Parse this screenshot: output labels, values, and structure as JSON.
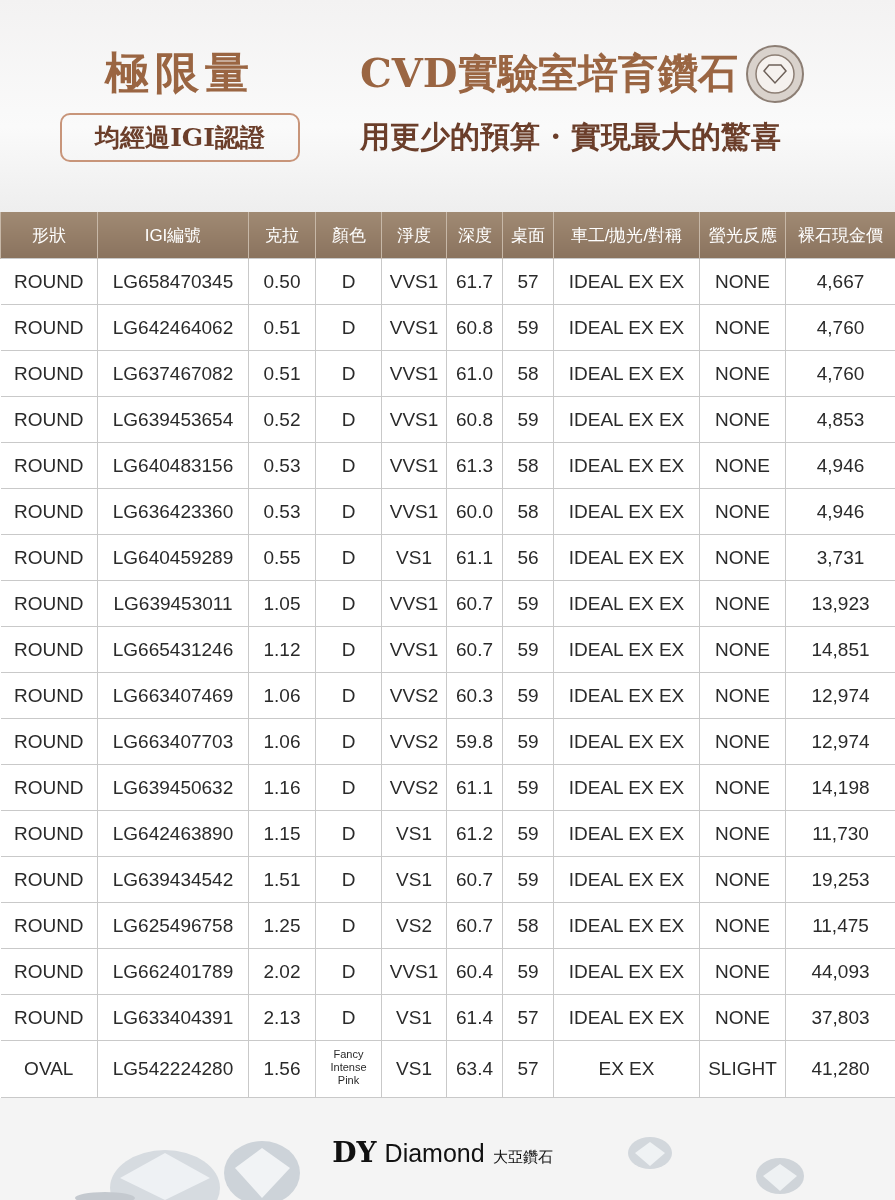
{
  "banner": {
    "headline": "極限量",
    "title": "CVD實驗室培育鑽石",
    "badge": "均經過IGI認證",
    "slogan": "用更少的預算 · 實現最大的驚喜"
  },
  "table": {
    "columns": [
      "形狀",
      "IGI編號",
      "克拉",
      "顏色",
      "淨度",
      "深度",
      "桌面",
      "車工/拋光/對稱",
      "螢光反應",
      "裸石現金價"
    ],
    "rows": [
      [
        "ROUND",
        "LG658470345",
        "0.50",
        "D",
        "VVS1",
        "61.7",
        "57",
        "IDEAL EX EX",
        "NONE",
        "4,667"
      ],
      [
        "ROUND",
        "LG642464062",
        "0.51",
        "D",
        "VVS1",
        "60.8",
        "59",
        "IDEAL EX EX",
        "NONE",
        "4,760"
      ],
      [
        "ROUND",
        "LG637467082",
        "0.51",
        "D",
        "VVS1",
        "61.0",
        "58",
        "IDEAL EX EX",
        "NONE",
        "4,760"
      ],
      [
        "ROUND",
        "LG639453654",
        "0.52",
        "D",
        "VVS1",
        "60.8",
        "59",
        "IDEAL EX EX",
        "NONE",
        "4,853"
      ],
      [
        "ROUND",
        "LG640483156",
        "0.53",
        "D",
        "VVS1",
        "61.3",
        "58",
        "IDEAL EX EX",
        "NONE",
        "4,946"
      ],
      [
        "ROUND",
        "LG636423360",
        "0.53",
        "D",
        "VVS1",
        "60.0",
        "58",
        "IDEAL EX EX",
        "NONE",
        "4,946"
      ],
      [
        "ROUND",
        "LG640459289",
        "0.55",
        "D",
        "VS1",
        "61.1",
        "56",
        "IDEAL EX EX",
        "NONE",
        "3,731"
      ],
      [
        "ROUND",
        "LG639453011",
        "1.05",
        "D",
        "VVS1",
        "60.7",
        "59",
        "IDEAL EX EX",
        "NONE",
        "13,923"
      ],
      [
        "ROUND",
        "LG665431246",
        "1.12",
        "D",
        "VVS1",
        "60.7",
        "59",
        "IDEAL EX EX",
        "NONE",
        "14,851"
      ],
      [
        "ROUND",
        "LG663407469",
        "1.06",
        "D",
        "VVS2",
        "60.3",
        "59",
        "IDEAL EX EX",
        "NONE",
        "12,974"
      ],
      [
        "ROUND",
        "LG663407703",
        "1.06",
        "D",
        "VVS2",
        "59.8",
        "59",
        "IDEAL EX EX",
        "NONE",
        "12,974"
      ],
      [
        "ROUND",
        "LG639450632",
        "1.16",
        "D",
        "VVS2",
        "61.1",
        "59",
        "IDEAL EX EX",
        "NONE",
        "14,198"
      ],
      [
        "ROUND",
        "LG642463890",
        "1.15",
        "D",
        "VS1",
        "61.2",
        "59",
        "IDEAL EX EX",
        "NONE",
        "11,730"
      ],
      [
        "ROUND",
        "LG639434542",
        "1.51",
        "D",
        "VS1",
        "60.7",
        "59",
        "IDEAL EX EX",
        "NONE",
        "19,253"
      ],
      [
        "ROUND",
        "LG625496758",
        "1.25",
        "D",
        "VS2",
        "60.7",
        "58",
        "IDEAL EX EX",
        "NONE",
        "11,475"
      ],
      [
        "ROUND",
        "LG662401789",
        "2.02",
        "D",
        "VVS1",
        "60.4",
        "59",
        "IDEAL EX EX",
        "NONE",
        "44,093"
      ],
      [
        "ROUND",
        "LG633404391",
        "2.13",
        "D",
        "VS1",
        "61.4",
        "57",
        "IDEAL EX EX",
        "NONE",
        "37,803"
      ],
      [
        "OVAL",
        "LG542224280",
        "1.56",
        "Fancy Intense Pink",
        "VS1",
        "63.4",
        "57",
        "EX EX",
        "SLIGHT",
        "41,280"
      ]
    ]
  },
  "footer": {
    "logo_mark": "DY",
    "brand": "Diamond",
    "brand_cn": "大亞鑽石"
  }
}
